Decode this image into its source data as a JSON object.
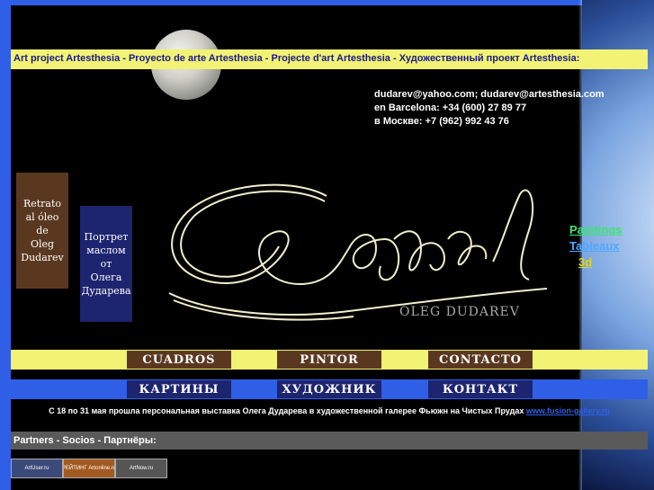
{
  "header": {
    "title": "Art project Artesthesia - Proyecto de arte Artesthesia - Projecte d'art Artesthesia - Художественный проект Artesthesia:"
  },
  "contacts": {
    "emails": "dudarev@yahoo.com; dudarev@artesthesia.com",
    "barcelona": "en Barcelona: +34 (600) 27 89 77",
    "moscow": "в Москве: +7 (962) 992 43 76"
  },
  "portrait_es": {
    "lines": [
      "Retrato",
      "al óleo",
      "de",
      "Oleg",
      "Dudarev"
    ]
  },
  "portrait_ru": {
    "lines": [
      "Портрет",
      "маслом",
      "от",
      "Олега",
      "Дударева"
    ]
  },
  "logo": {
    "name": "OLEG DUDAREV"
  },
  "side_links": {
    "paintings": "Paintings",
    "tableaux": "Tableaux",
    "three_d": "3d"
  },
  "nav_es": [
    "CUADROS",
    "PINTOR",
    "CONTACTO"
  ],
  "nav_ru": [
    "КАРТИНЫ",
    "ХУДОЖНИК",
    "КОНТАКТ"
  ],
  "news": {
    "text": "С 18 по 31 мая прошла персональная выставка Олега Дударева в художественной галерее Фьюжн на Чистых Прудах",
    "link": "www.fusion-gallery.ru"
  },
  "partners": {
    "label": "Partners - Socios - Партнёры:"
  },
  "banners": [
    "ArtUser.ru",
    "РЕЙТИНГ Artonline.ru",
    "ArtNow.ru"
  ],
  "colors": {
    "frame": "#2f5fe6",
    "yellow_bar": "#f2f274",
    "brown": "#5a3820",
    "navy": "#1d2470"
  }
}
